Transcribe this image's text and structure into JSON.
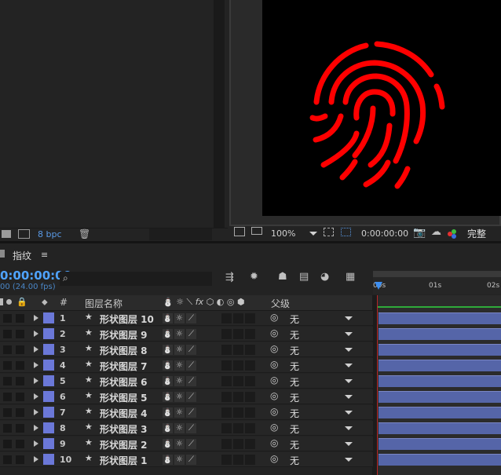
{
  "project_panel": {
    "bpc": "8 bpc"
  },
  "viewer": {
    "zoom": "100%",
    "timecode": "0:00:00:00",
    "resolution": "完整",
    "artwork_color": "#ff0000"
  },
  "timeline": {
    "tab_label": "指纹",
    "timecode": "0:00:00:00",
    "fps": "00 (24.00 fps)",
    "search_placeholder": "",
    "ruler_ticks": [
      "00s",
      "01s",
      "02s"
    ],
    "columns": {
      "number": "#",
      "layer_name": "图层名称",
      "parent": "父级"
    },
    "label_color": "#6b78d8",
    "bar_color": "#5565a8",
    "layers": [
      {
        "num": "1",
        "name": "形状图层 10",
        "parent": "无"
      },
      {
        "num": "2",
        "name": "形状图层 9",
        "parent": "无"
      },
      {
        "num": "3",
        "name": "形状图层 8",
        "parent": "无"
      },
      {
        "num": "4",
        "name": "形状图层 7",
        "parent": "无"
      },
      {
        "num": "5",
        "name": "形状图层 6",
        "parent": "无"
      },
      {
        "num": "6",
        "name": "形状图层 5",
        "parent": "无"
      },
      {
        "num": "7",
        "name": "形状图层 4",
        "parent": "无"
      },
      {
        "num": "8",
        "name": "形状图层 3",
        "parent": "无"
      },
      {
        "num": "9",
        "name": "形状图层 2",
        "parent": "无"
      },
      {
        "num": "10",
        "name": "形状图层 1",
        "parent": "无"
      }
    ]
  }
}
